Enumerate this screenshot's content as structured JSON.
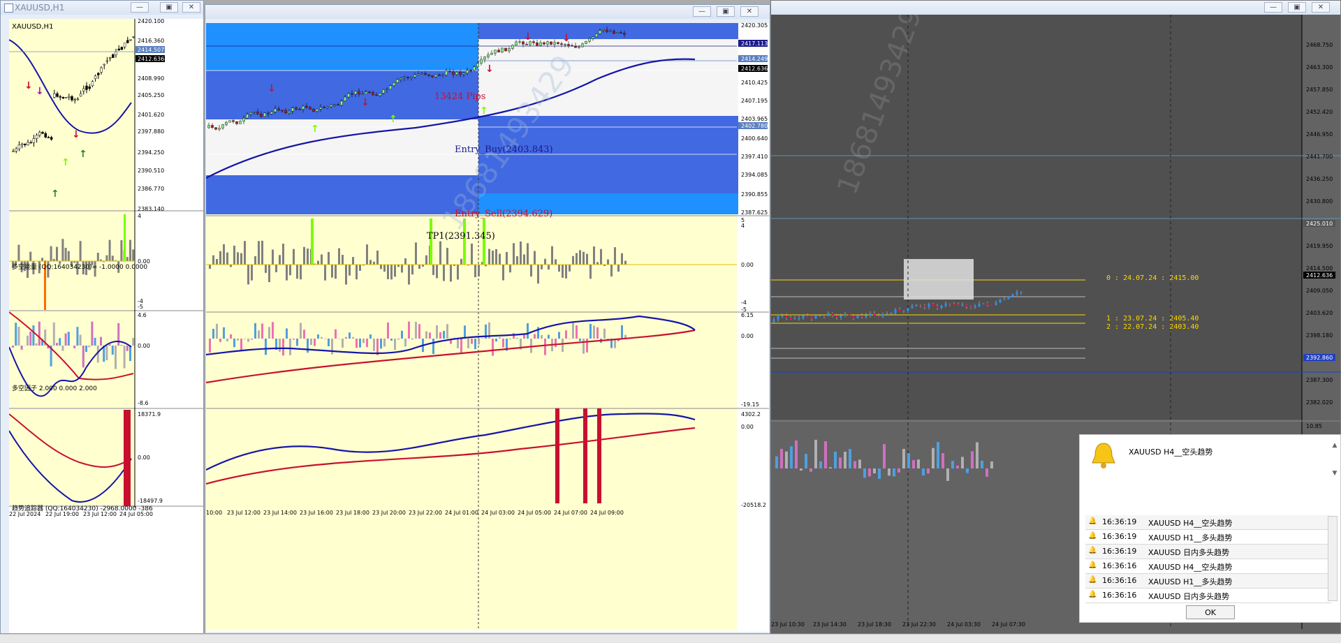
{
  "window1": {
    "title": "XAUUSD,H1",
    "symbol_label": "XAUUSD,H1",
    "price_axis": [
      "2420.100",
      "2416.360",
      "2414.507",
      "2412.636",
      "2408.990",
      "2405.250",
      "2401.620",
      "2397.880",
      "2394.250",
      "2390.510",
      "2386.770",
      "2383.140"
    ],
    "ind1_label": "多空能量 (QQ:164034230)= -1.0000 0.0000",
    "ind1_axis": [
      "4",
      "0.00",
      "-4",
      "-5"
    ],
    "ind2_label": "多空因子 2.000 0.000 2.000",
    "ind2_axis": [
      "4.6",
      "0.00",
      "-8.6"
    ],
    "ind3_label": "趋势追踪器 (QQ:164034230)  -2968.0000 -386",
    "ind3_axis": [
      "18371.9",
      "0.00",
      "-18497.9"
    ],
    "time_axis": [
      "22 Jul 2024",
      "22 Jul 19:00",
      "23 Jul 12:00",
      "24 Jul 05:00"
    ]
  },
  "window2": {
    "price_axis": [
      "2420.305",
      "2417.113",
      "2414.249",
      "2412.636",
      "2410.425",
      "2407.195",
      "2403.965",
      "2402.780",
      "2400.640",
      "2397.410",
      "2394.085",
      "2390.855",
      "2387.625"
    ],
    "annotations": {
      "pips": "13424 Pips",
      "entry_buy": "Entry_Buy(2403.843)",
      "entry_sell": "Entry_Sell(2394.629)",
      "tp1": "TP1(2391.345)"
    },
    "ind1_axis": [
      "5",
      "4",
      "0.00",
      "-4",
      "-5"
    ],
    "ind2_axis": [
      "6.15",
      "0.00",
      "-19.15"
    ],
    "ind3_axis": [
      "4302.2",
      "0.00",
      "-20518.2"
    ],
    "time_axis": [
      "10:00",
      "23 Jul 12:00",
      "23 Jul 14:00",
      "23 Jul 16:00",
      "23 Jul 18:00",
      "23 Jul 20:00",
      "23 Jul 22:00",
      "24 Jul 01:00",
      "24 Jul 03:00",
      "24 Jul 05:00",
      "24 Jul 07:00",
      "24 Jul 09:00"
    ]
  },
  "window3": {
    "price_axis": [
      "2468.750",
      "2463.300",
      "2457.850",
      "2452.420",
      "2446.950",
      "2441.700",
      "2436.250",
      "2430.800",
      "2425.010",
      "2419.950",
      "2414.500",
      "2412.636",
      "2409.050",
      "2403.620",
      "2398.180",
      "2392.860",
      "2387.300",
      "2382.020"
    ],
    "ind_axis": [
      "10.85"
    ],
    "levels": [
      "0 : 24.07.24 : 2415.00",
      "1 : 23.07.24 : 2405.40",
      "2 : 22.07.24 : 2403.40"
    ],
    "time_axis": [
      "23 Jul 10:30",
      "23 Jul 14:30",
      "23 Jul 18:30",
      "23 Jul 22:30",
      "24 Jul 03:30",
      "24 Jul 07:30"
    ]
  },
  "alert": {
    "headline": "XAUUSD  H4__空头趋势",
    "rows": [
      {
        "time": "16:36:19",
        "msg": "XAUUSD  H4__空头趋势"
      },
      {
        "time": "16:36:19",
        "msg": "XAUUSD  H1__多头趋势"
      },
      {
        "time": "16:36:19",
        "msg": "XAUUSD  日内多头趋势"
      },
      {
        "time": "16:36:16",
        "msg": "XAUUSD  H4__空头趋势"
      },
      {
        "time": "16:36:16",
        "msg": "XAUUSD  H1__多头趋势"
      },
      {
        "time": "16:36:16",
        "msg": "XAUUSD  日内多头趋势"
      }
    ],
    "ok_label": "OK"
  },
  "watermark": "18681493429",
  "colors": {
    "chart_bg": "#FFFFD0",
    "blue_zone": "#4169E1",
    "sky": "#1E90FF",
    "bull": "#32CD32",
    "bear": "#B22222",
    "dark_bg": "#505050"
  }
}
